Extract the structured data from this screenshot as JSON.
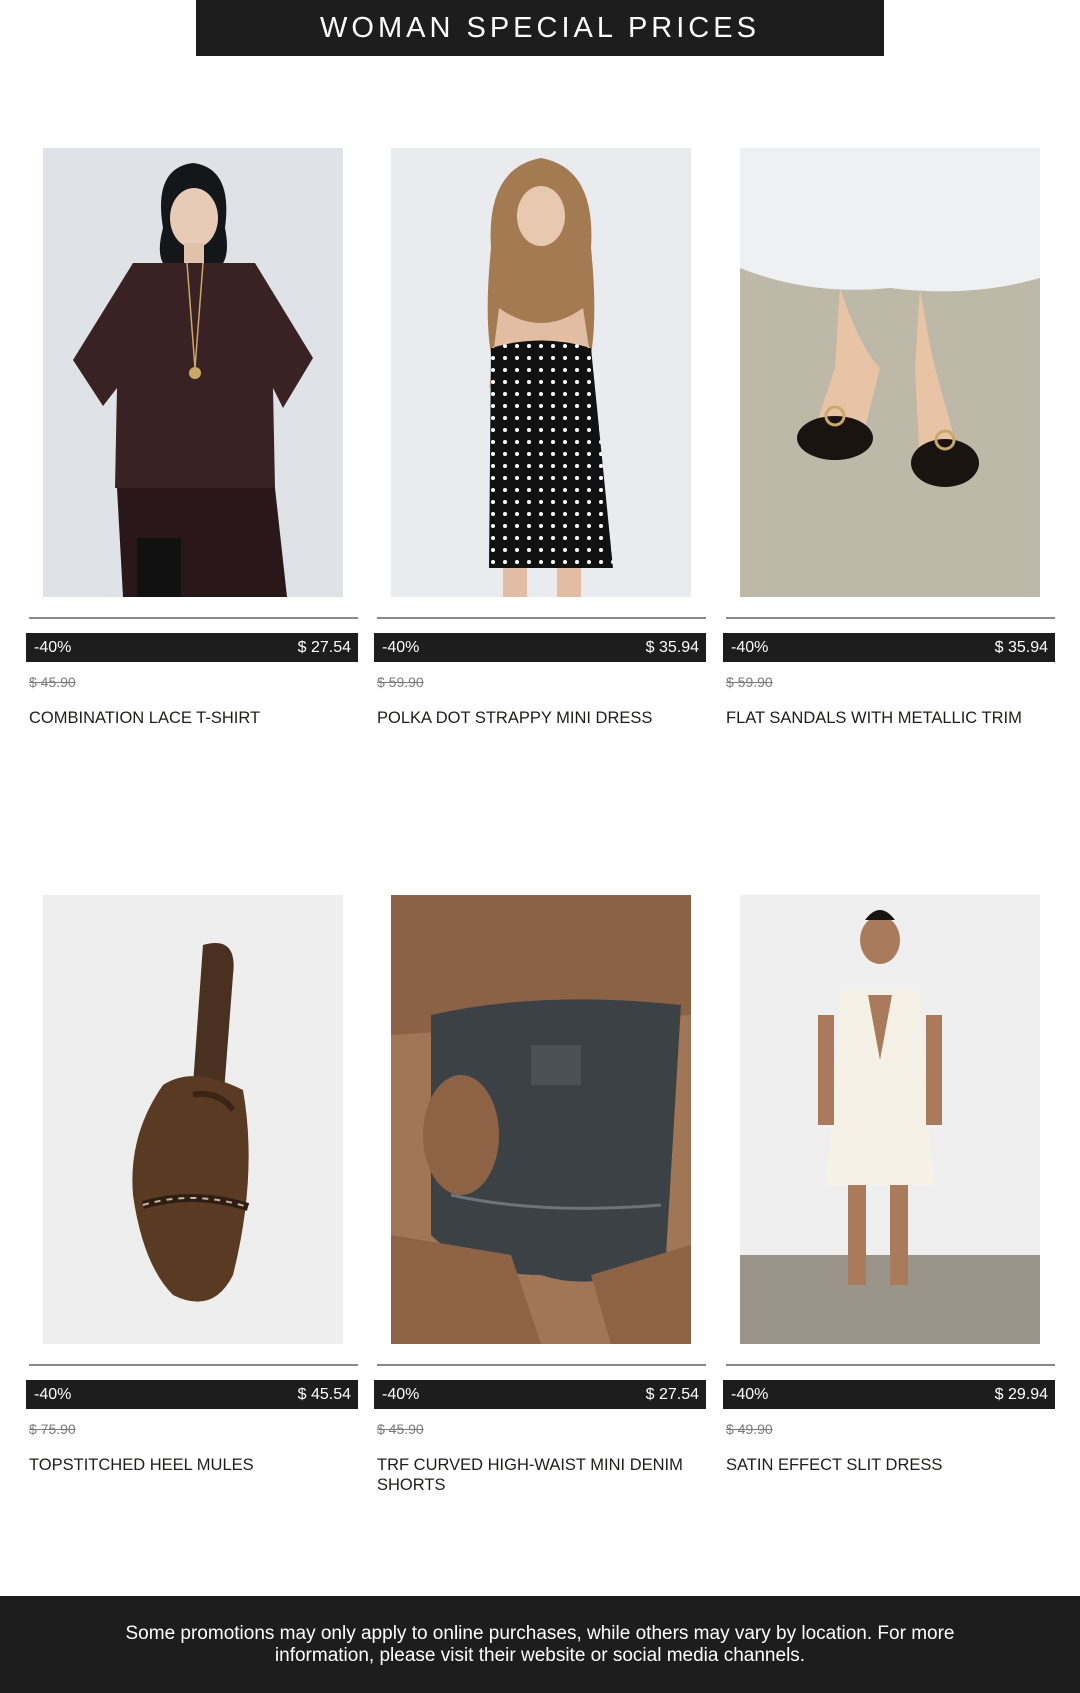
{
  "header": {
    "title": "WOMAN SPECIAL PRICES"
  },
  "products": [
    {
      "photo": "woman-in-oversized-tshirt-photo",
      "discount": "-40%",
      "price": "$ 27.54",
      "old_price": "$ 45.90",
      "name": "COMBINATION LACE T-SHIRT",
      "colors": {
        "bg": "#dfe3e8",
        "main": "#3a2123"
      }
    },
    {
      "photo": "woman-in-polka-dot-dress-photo",
      "discount": "-40%",
      "price": "$ 35.94",
      "old_price": "$ 59.90",
      "name": "POLKA DOT STRAPPY MINI DRESS",
      "colors": {
        "bg": "#e9ebee",
        "main": "#111111"
      }
    },
    {
      "photo": "feet-in-flat-sandals-photo",
      "discount": "-40%",
      "price": "$ 35.94",
      "old_price": "$ 59.90",
      "name": "FLAT SANDALS WITH METALLIC TRIM",
      "colors": {
        "bg": "#bdb8a8",
        "main": "#1a1411"
      }
    },
    {
      "photo": "brown-heel-mule-photo",
      "discount": "-40%",
      "price": "$ 45.54",
      "old_price": "$ 75.90",
      "name": "TOPSTITCHED HEEL MULES",
      "colors": {
        "bg": "#eeeeee",
        "main": "#5a3a22"
      }
    },
    {
      "photo": "denim-shorts-closeup-photo",
      "discount": "-40%",
      "price": "$ 27.54",
      "old_price": "$ 45.90",
      "name": "TRF CURVED HIGH-WAIST MINI DENIM SHORTS",
      "colors": {
        "bg": "#a07656",
        "main": "#3c4146"
      }
    },
    {
      "photo": "woman-in-satin-dress-photo",
      "discount": "-40%",
      "price": "$ 29.94",
      "old_price": "$ 49.90",
      "name": "SATIN EFFECT SLIT DRESS",
      "colors": {
        "bg": "#efefef",
        "main": "#f6f1e6"
      }
    }
  ],
  "footer": {
    "text": "Some promotions may only apply to online purchases, while others may vary by location. For more information, please visit their website or social media channels."
  }
}
